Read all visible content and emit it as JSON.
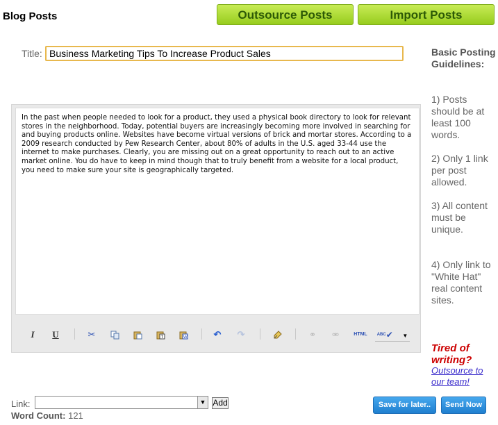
{
  "header": {
    "title": "Blog Posts",
    "outsource_label": "Outsource Posts",
    "import_label": "Import Posts"
  },
  "form": {
    "title_label": "Title:",
    "title_value": "Business Marketing Tips To Increase Product Sales",
    "body_text": "In the past when people needed to look for a product, they used a physical book directory to look for relevant stores in the neighborhood. Today, potential buyers are increasingly becoming more involved in searching for and buying products online. Websites have become virtual versions of brick and mortar stores. According to a 2009 research conducted by Pew Research Center, about 80% of adults in the U.S. aged 33-44 use the internet to make purchases. Clearly, you are missing out on a great opportunity to reach out to an active market online. You do have to keep in mind though that to truly benefit from a website for a local product, you need to make sure your site is geographically targeted.",
    "link_label": "Link:",
    "link_value": "",
    "add_label": "Add",
    "word_count_label": "Word Count:",
    "word_count": "121",
    "save_label": "Save for later..",
    "send_label": "Send Now"
  },
  "toolbar": {
    "items": [
      "italic-icon",
      "underline-icon",
      "cut-icon",
      "copy-icon",
      "paste-icon",
      "paste-text-icon",
      "paste-word-icon",
      "undo-icon",
      "redo-icon",
      "clean-icon",
      "link-icon",
      "unlink-icon",
      "html-icon",
      "spellcheck-icon"
    ],
    "italic": "I",
    "underline": "U",
    "html": "HTML",
    "spell": "ABC"
  },
  "guidelines": {
    "heading": "Basic Posting Guidelines:",
    "items": [
      "1) Posts should be at least 100 words.",
      "2) Only 1 link per post allowed.",
      "3) All content must be unique.",
      "4) Only link to \"White Hat\" real content sites."
    ]
  },
  "promo": {
    "tired": "Tired of writing?",
    "link": "Outsource to our team!"
  },
  "colors": {
    "green_button": "#a6d62c",
    "blue_button": "#2b8ad8",
    "title_border": "#e8b84e",
    "promo_red": "#cc0000"
  }
}
